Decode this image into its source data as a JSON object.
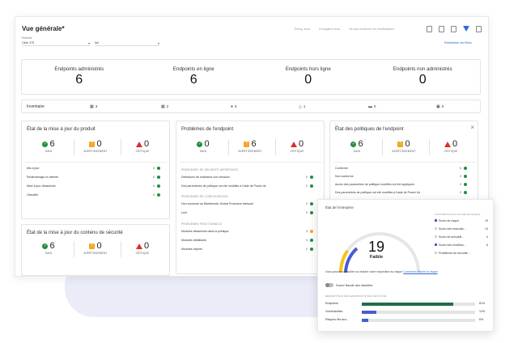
{
  "page": {
    "title": "Vue générale*",
    "actions": [
      "Enreg. sous",
      "Enregistrer sous",
      "Ne pas conserver les modifications"
    ],
    "filter_label": "Endroits",
    "filter_value": "Cible 375",
    "filter2_value": "Ital",
    "reset_filters": "Réinitialiser les filtres"
  },
  "counts": [
    {
      "label": "Endpoints administrés",
      "value": "6"
    },
    {
      "label": "Endpoints en ligne",
      "value": "6"
    },
    {
      "label": "Endpoints hors ligne",
      "value": "0"
    },
    {
      "label": "Endpoints non administrés",
      "value": "0"
    }
  ],
  "inventory": {
    "label": "Inventaire",
    "items": [
      {
        "icon": "windows-icon",
        "glyph": "▦",
        "value": "3"
      },
      {
        "icon": "windows-server-icon",
        "glyph": "▦",
        "value": "2"
      },
      {
        "icon": "apple-icon",
        "glyph": "●",
        "value": "0"
      },
      {
        "icon": "linux-icon",
        "glyph": "△",
        "value": "1"
      },
      {
        "icon": "monitor-icon",
        "glyph": "▬",
        "value": "0"
      },
      {
        "icon": "server-icon",
        "glyph": "▣",
        "value": "0"
      }
    ]
  },
  "status_labels": {
    "ok": "SAIN",
    "warn": "AVERTISSEMENT",
    "crit": "CRITIQUE"
  },
  "panel_product": {
    "title": "État de la mise à jour du produit",
    "ok": "6",
    "warn": "0",
    "crit": "0",
    "rows": [
      {
        "label": "Mis à jour",
        "a": "6",
        "b": "0"
      },
      {
        "label": "Redémarrage en attente",
        "a": "6",
        "b": "0"
      },
      {
        "label": "Mise à jour désactivée",
        "a": "6",
        "b": "0"
      },
      {
        "label": "Obsolète",
        "a": "6",
        "b": "0"
      }
    ]
  },
  "panel_content": {
    "title": "État de la mise à jour du contenu de sécurité",
    "ok": "6",
    "warn": "0",
    "crit": "0"
  },
  "panel_endpoint": {
    "title": "Problèmes de l'endpoint",
    "ok": "0",
    "warn": "6",
    "crit": "0",
    "sec1": "PROBLÈMES DE SÉCURITÉ IMPORTANTS",
    "sec1_rows": [
      {
        "label": "Détections de malwares non résolues",
        "a": "0",
        "b": "0"
      },
      {
        "label": "Des paramètres de politique ont été modifiés à l'aide de Power de",
        "a": "0",
        "b": "6"
      }
    ],
    "sec2": "PROBLÈMES DE CONFIGURATION",
    "sec2_rows": [
      {
        "label": "Non connecté au Bitdefender Global Protective Network",
        "a": "0",
        "b": "0"
      },
      {
        "label": "Lent",
        "a": "0",
        "b": "0"
      }
    ],
    "sec3": "PROBLÈMES FONCTIONNELS",
    "sec3_rows": [
      {
        "label": "Modules désactivés dans la politique",
        "a": "0",
        "b": "0"
      },
      {
        "label": "Modules défaillants",
        "a": "0",
        "b": "0"
      },
      {
        "label": "Modules expirés",
        "a": "0",
        "b": "0"
      }
    ]
  },
  "panel_policy": {
    "title": "État des politiques de l'endpoint",
    "ok": "6",
    "warn": "0",
    "crit": "0",
    "rows": [
      {
        "label": "Conforme",
        "a": "6",
        "b": "0"
      },
      {
        "label": "Non conforme",
        "a": "0",
        "b": "0"
      },
      {
        "label": "Accès des paramètres de politique modifiés ont été appliqués",
        "a": "0",
        "b": "0"
      },
      {
        "label": "Des paramètres de politique ont été modifiés à l'aide de Power Us",
        "a": "0",
        "b": "0"
      }
    ]
  },
  "risk_card": {
    "title": "État de l'entreprise",
    "score": "19",
    "score_label": "Faible",
    "legend_header": "CONTRIBUTION AU SCORE DE RISQUE",
    "legend": [
      {
        "label": "Score de risque",
        "value": "19",
        "color": "#4a5bcf"
      },
      {
        "label": "Score des mauvais...",
        "value": "14",
        "color": "#ffffff"
      },
      {
        "label": "Score de sensibili...",
        "value": "0",
        "color": "#ffffff"
      },
      {
        "label": "Score des modifica...",
        "value": "6",
        "color": "#4a5bcf"
      },
      {
        "label": "Problèmes de sécurité...",
        "value": "",
        "color": "#ffffff"
      }
    ],
    "info": "Vous pouvez consulter ou réduire votre exposition au risque",
    "info_link": "Comment réduire le risque",
    "toggle": "Suivre Bande des Identités",
    "bars_header": "RÉPARTITION DES ENDPOINTS PAR CRITICITÉ",
    "bars": [
      {
        "label": "Endpoints",
        "value": "81%",
        "fill": 0.81,
        "color": "#1e6e48"
      },
      {
        "label": "Vulnérabilités",
        "value": "13%",
        "fill": 0.13,
        "color": "#4a5bcf"
      },
      {
        "label": "Risques liés aux...",
        "value": "6%",
        "fill": 0.06,
        "color": "#4a5bcf"
      }
    ],
    "gauge_fill": 0.19
  }
}
